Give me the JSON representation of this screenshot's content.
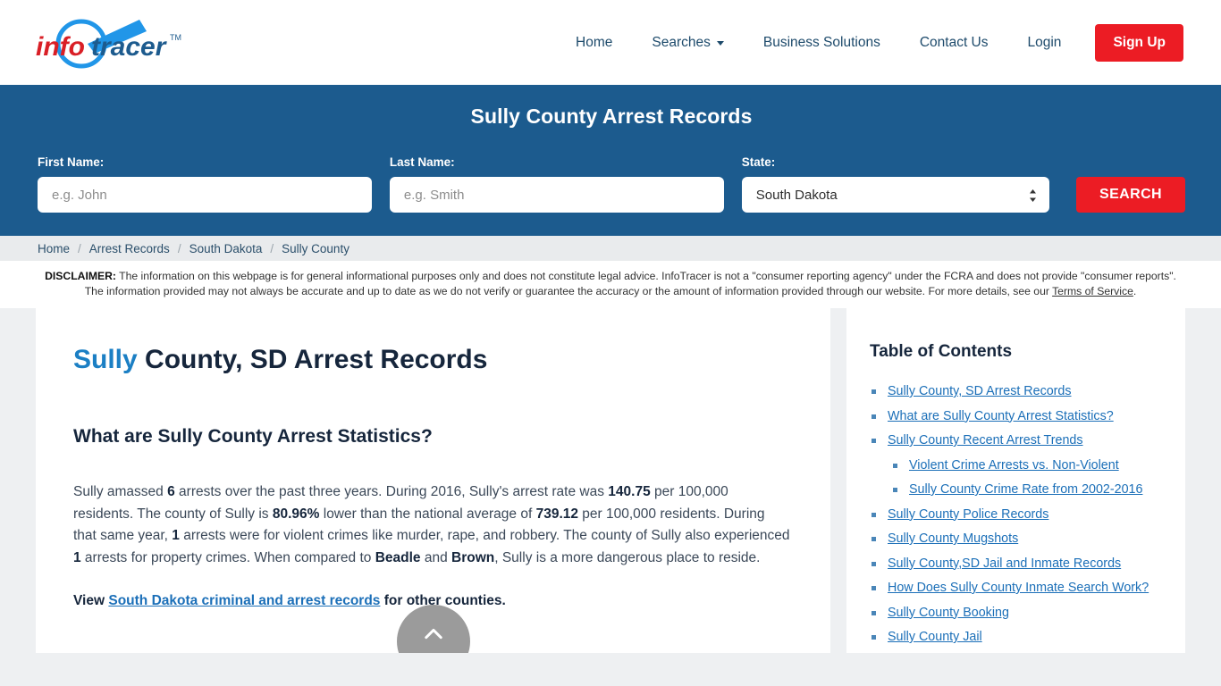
{
  "header": {
    "logo_alt": "infotracer",
    "logo_text_info": "info",
    "logo_text_tracer": "tracer",
    "logo_tm": "TM",
    "nav": [
      {
        "label": "Home",
        "has_caret": false
      },
      {
        "label": "Searches",
        "has_caret": true
      },
      {
        "label": "Business Solutions",
        "has_caret": false
      },
      {
        "label": "Contact Us",
        "has_caret": false
      },
      {
        "label": "Login",
        "has_caret": false
      }
    ],
    "signup_label": "Sign Up",
    "signup_color": "#ec1c24"
  },
  "search_band": {
    "title": "Sully County Arrest Records",
    "background_color": "#1c5b8e",
    "first_name_label": "First Name:",
    "first_name_placeholder": "e.g. John",
    "first_name_value": "",
    "last_name_label": "Last Name:",
    "last_name_placeholder": "e.g. Smith",
    "last_name_value": "",
    "state_label": "State:",
    "state_selected": "South Dakota",
    "state_options": [
      "South Dakota"
    ],
    "search_label": "SEARCH"
  },
  "breadcrumb": {
    "separator": "/",
    "items": [
      {
        "label": "Home",
        "current": false
      },
      {
        "label": "Arrest Records",
        "current": false
      },
      {
        "label": "South Dakota",
        "current": false
      },
      {
        "label": "Sully County",
        "current": true
      }
    ]
  },
  "disclaimer": {
    "label": "DISCLAIMER:",
    "text": " The information on this webpage is for general informational purposes only and does not constitute legal advice. InfoTracer is not a \"consumer reporting agency\" under the FCRA and does not provide \"consumer reports\". The information provided may not always be accurate and up to date as we do not verify or guarantee the accuracy or the amount of information provided through our website. For more details, see our ",
    "link_label": "Terms of Service",
    "text_end": "."
  },
  "main": {
    "title_accent": "Sully",
    "title_rest": " County, SD Arrest Records",
    "section_heading": "What are Sully County Arrest Statistics?",
    "paragraph": {
      "p1": "Sully amassed ",
      "b1": "6",
      "p2": " arrests over the past three years. During 2016, Sully's arrest rate was ",
      "b2": "140.75",
      "p3": " per 100,000 residents. The county of Sully is ",
      "b3": "80.96%",
      "p4": " lower than the national average of ",
      "b4": "739.12",
      "p5": " per 100,000 residents. During that same year, ",
      "b5": "1",
      "p6": " arrests were for violent crimes like murder, rape, and robbery. The county of Sully also experienced ",
      "b6": "1",
      "p7": " arrests for property crimes. When compared to ",
      "b7": "Beadle",
      "p8": " and ",
      "b8": "Brown",
      "p9": ", Sully is a more dangerous place to reside."
    },
    "view_prefix": "View ",
    "view_link": "South Dakota criminal and arrest records",
    "view_suffix": " for other counties.",
    "scroll_top_icon": "chevron-up-icon"
  },
  "toc": {
    "title": "Table of Contents",
    "items": [
      {
        "label": "Sully County, SD Arrest Records",
        "sub": false
      },
      {
        "label": "What are Sully County Arrest Statistics?",
        "sub": false
      },
      {
        "label": "Sully County Recent Arrest Trends",
        "sub": false
      },
      {
        "label": "Violent Crime Arrests vs. Non-Violent",
        "sub": true
      },
      {
        "label": "Sully County Crime Rate from 2002-2016",
        "sub": true
      },
      {
        "label": "Sully County Police Records",
        "sub": false
      },
      {
        "label": "Sully County Mugshots",
        "sub": false
      },
      {
        "label": "Sully County,SD Jail and Inmate Records",
        "sub": false
      },
      {
        "label": "How Does Sully County Inmate Search Work?",
        "sub": false
      },
      {
        "label": "Sully County Booking",
        "sub": false
      },
      {
        "label": "Sully County Jail",
        "sub": false
      }
    ]
  }
}
